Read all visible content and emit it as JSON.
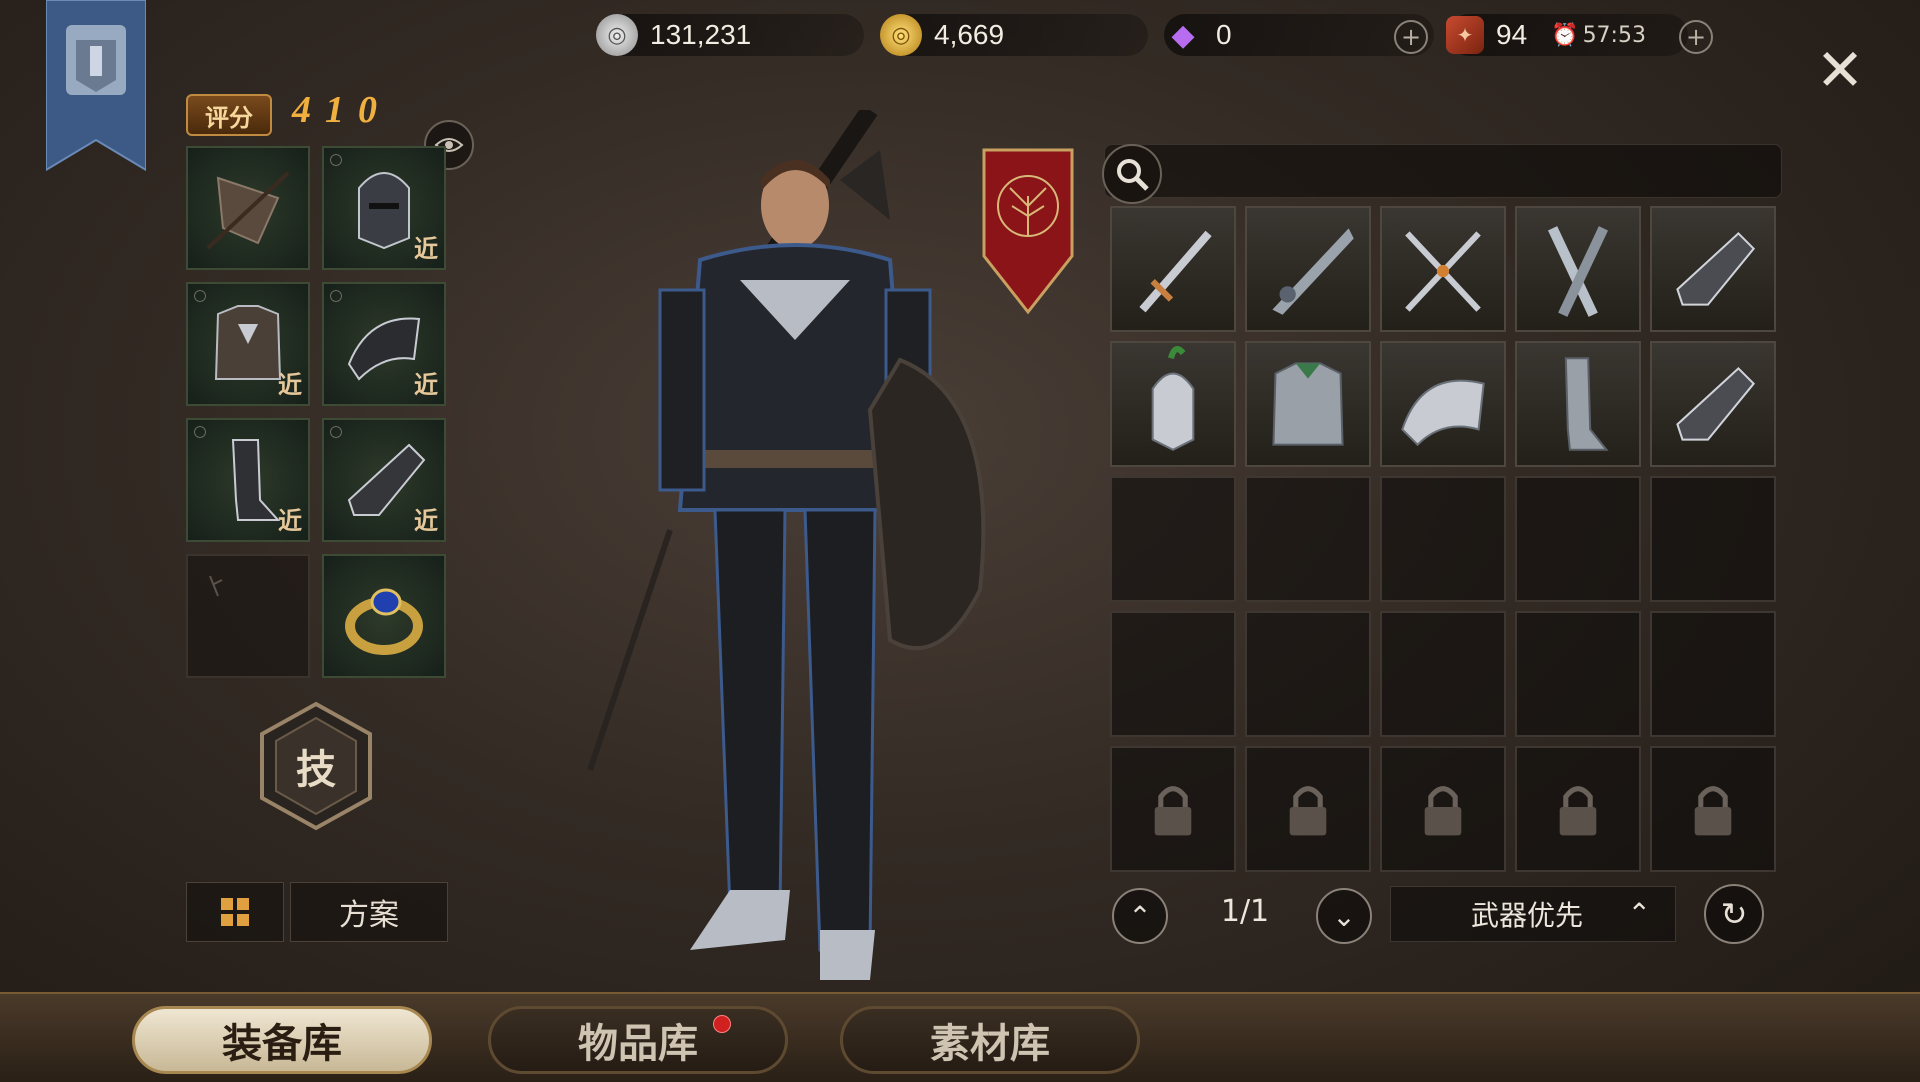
{
  "currencies": {
    "silver": "131,231",
    "gold": "4,669",
    "gem": "0",
    "stamina": "94",
    "timer": "57:53"
  },
  "score": {
    "label": "评分",
    "value": "410"
  },
  "equipment_slots": [
    {
      "icon": "shoulder-armor-icon",
      "tag": ""
    },
    {
      "icon": "helmet-icon",
      "tag": "近"
    },
    {
      "icon": "chest-armor-icon",
      "tag": "近"
    },
    {
      "icon": "pauldron-icon",
      "tag": "近"
    },
    {
      "icon": "greaves-icon",
      "tag": "近"
    },
    {
      "icon": "gauntlet-icon",
      "tag": "近"
    },
    {
      "icon": "empty-slot-icon",
      "tag": ""
    },
    {
      "icon": "ring-icon",
      "tag": ""
    }
  ],
  "skill_button": "技",
  "plan_button": "方案",
  "inventory_items": [
    "longsword-icon",
    "greatsword-icon",
    "crossed-swords-icon",
    "twin-blades-icon",
    "gauntlet-icon",
    "helmet-icon",
    "chest-armor-icon",
    "pauldron-icon",
    "greaves-icon",
    "gauntlet-icon"
  ],
  "pager": {
    "page": "1/1"
  },
  "sort": {
    "label": "武器优先"
  },
  "tabs": [
    {
      "label": "装备库",
      "active": true
    },
    {
      "label": "物品库",
      "active": false,
      "badge": true
    },
    {
      "label": "素材库",
      "active": false
    }
  ],
  "colors": {
    "accent_gold": "#f0b040",
    "slot_green": "#2e3a2a",
    "badge_red": "#d02020"
  }
}
